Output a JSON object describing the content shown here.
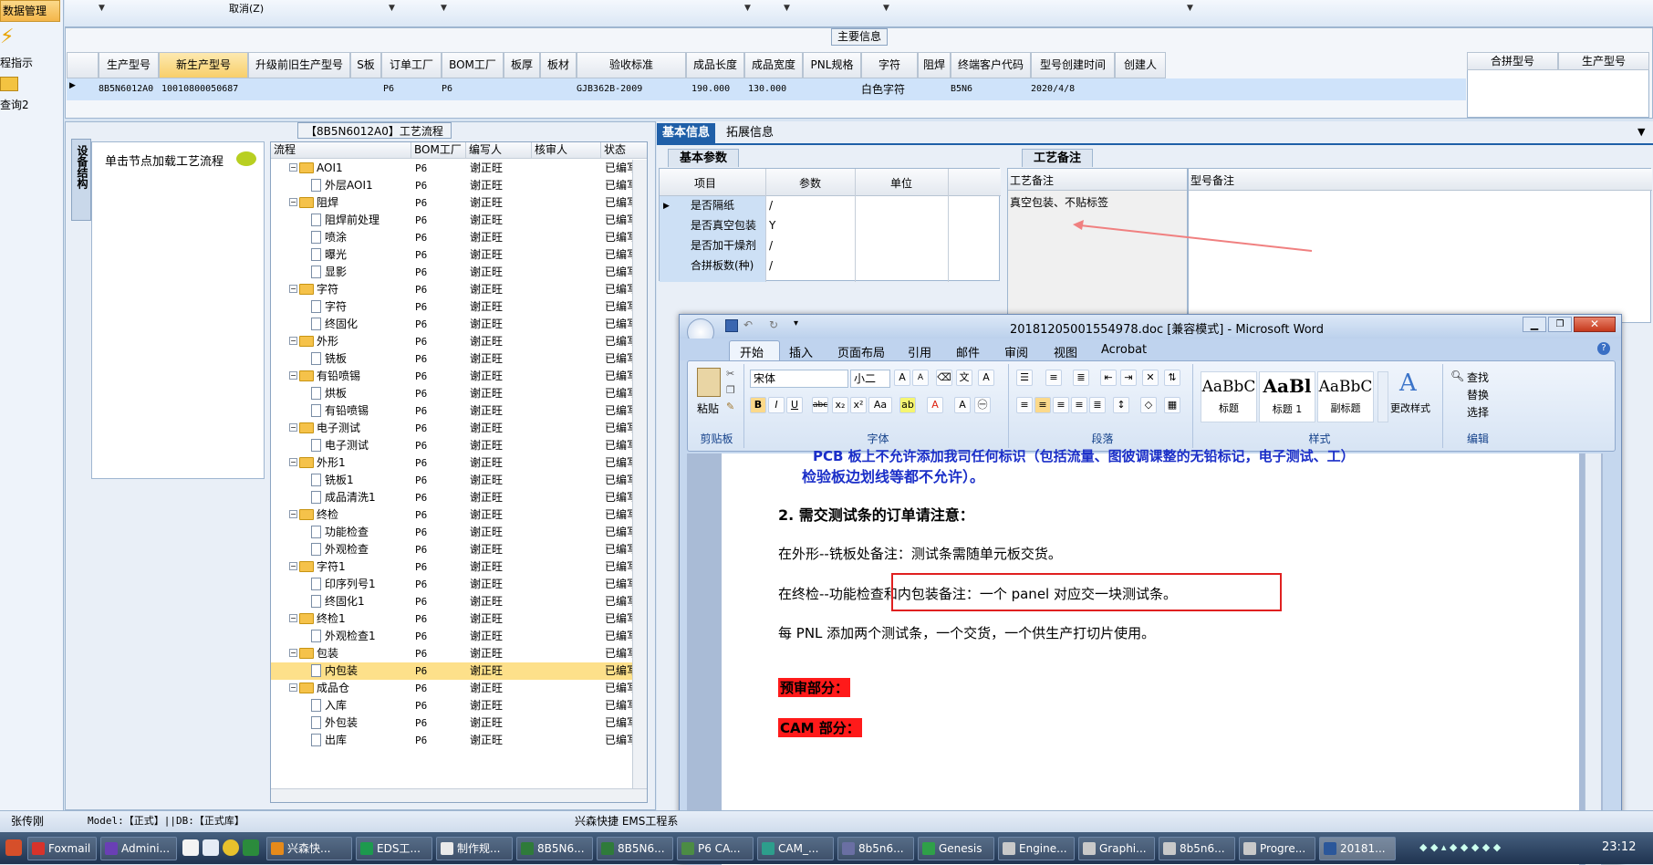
{
  "left_nav": {
    "selected": "数据管理",
    "items": [
      "程指示",
      "查询2"
    ]
  },
  "top_bar": {
    "cancel": "取消(Z)"
  },
  "main_info": {
    "group_title": "主要信息",
    "headers": [
      "生产型号",
      "新生产型号",
      "升级前旧生产型号",
      "S板",
      "订单工厂",
      "BOM工厂",
      "板厚",
      "板材",
      "验收标准",
      "成品长度",
      "成品宽度",
      "PNL规格",
      "字符",
      "阻焊",
      "终端客户代码",
      "型号创建时间",
      "创建人"
    ],
    "row": {
      "c0": "8B5N6012A0",
      "c1": "10010800050687",
      "c4": "P6",
      "c5": "P6",
      "c8": "GJB362B-2009",
      "c9": "190.000",
      "c10": "130.000",
      "c12": "白色字符",
      "c14": "B5N6",
      "c15": "2020/4/8"
    },
    "right_headers": [
      "合拼型号",
      "生产型号"
    ]
  },
  "flow": {
    "title": "【8B5N6012A0】工艺流程",
    "side_tab": "设备结构",
    "node_hint": "单击节点加载工艺流程",
    "columns": [
      "流程",
      "BOM工厂",
      "编写人",
      "核审人",
      "状态"
    ],
    "rows": [
      {
        "name": "AOI1",
        "type": "folder",
        "bom": "P6",
        "writer": "谢正旺",
        "status": "已编写"
      },
      {
        "name": "外层AOI1",
        "type": "doc",
        "bom": "P6",
        "writer": "谢正旺",
        "status": "已编写"
      },
      {
        "name": "阻焊",
        "type": "folder",
        "bom": "P6",
        "writer": "谢正旺",
        "status": "已编写"
      },
      {
        "name": "阻焊前处理",
        "type": "doc",
        "bom": "P6",
        "writer": "谢正旺",
        "status": "已编写"
      },
      {
        "name": "喷涂",
        "type": "doc",
        "bom": "P6",
        "writer": "谢正旺",
        "status": "已编写"
      },
      {
        "name": "曝光",
        "type": "doc",
        "bom": "P6",
        "writer": "谢正旺",
        "status": "已编写"
      },
      {
        "name": "显影",
        "type": "doc",
        "bom": "P6",
        "writer": "谢正旺",
        "status": "已编写"
      },
      {
        "name": "字符",
        "type": "folder",
        "bom": "P6",
        "writer": "谢正旺",
        "status": "已编写"
      },
      {
        "name": "字符",
        "type": "doc",
        "bom": "P6",
        "writer": "谢正旺",
        "status": "已编写"
      },
      {
        "name": "终固化",
        "type": "doc",
        "bom": "P6",
        "writer": "谢正旺",
        "status": "已编写"
      },
      {
        "name": "外形",
        "type": "folder",
        "bom": "P6",
        "writer": "谢正旺",
        "status": "已编写"
      },
      {
        "name": "铣板",
        "type": "doc",
        "bom": "P6",
        "writer": "谢正旺",
        "status": "已编写"
      },
      {
        "name": "有铅喷锡",
        "type": "folder",
        "bom": "P6",
        "writer": "谢正旺",
        "status": "已编写"
      },
      {
        "name": "烘板",
        "type": "doc",
        "bom": "P6",
        "writer": "谢正旺",
        "status": "已编写"
      },
      {
        "name": "有铅喷锡",
        "type": "doc",
        "bom": "P6",
        "writer": "谢正旺",
        "status": "已编写"
      },
      {
        "name": "电子测试",
        "type": "folder",
        "bom": "P6",
        "writer": "谢正旺",
        "status": "已编写"
      },
      {
        "name": "电子测试",
        "type": "doc",
        "bom": "P6",
        "writer": "谢正旺",
        "status": "已编写"
      },
      {
        "name": "外形1",
        "type": "folder",
        "bom": "P6",
        "writer": "谢正旺",
        "status": "已编写"
      },
      {
        "name": "铣板1",
        "type": "doc",
        "bom": "P6",
        "writer": "谢正旺",
        "status": "已编写"
      },
      {
        "name": "成品清洗1",
        "type": "doc",
        "bom": "P6",
        "writer": "谢正旺",
        "status": "已编写"
      },
      {
        "name": "终检",
        "type": "folder",
        "bom": "P6",
        "writer": "谢正旺",
        "status": "已编写"
      },
      {
        "name": "功能检查",
        "type": "doc",
        "bom": "P6",
        "writer": "谢正旺",
        "status": "已编写"
      },
      {
        "name": "外观检查",
        "type": "doc",
        "bom": "P6",
        "writer": "谢正旺",
        "status": "已编写"
      },
      {
        "name": "字符1",
        "type": "folder",
        "bom": "P6",
        "writer": "谢正旺",
        "status": "已编写"
      },
      {
        "name": "印序列号1",
        "type": "doc",
        "bom": "P6",
        "writer": "谢正旺",
        "status": "已编写"
      },
      {
        "name": "终固化1",
        "type": "doc",
        "bom": "P6",
        "writer": "谢正旺",
        "status": "已编写"
      },
      {
        "name": "终检1",
        "type": "folder",
        "bom": "P6",
        "writer": "谢正旺",
        "status": "已编写"
      },
      {
        "name": "外观检查1",
        "type": "doc",
        "bom": "P6",
        "writer": "谢正旺",
        "status": "已编写"
      },
      {
        "name": "包装",
        "type": "folder",
        "bom": "P6",
        "writer": "谢正旺",
        "status": "已编写"
      },
      {
        "name": "内包装",
        "type": "doc",
        "bom": "P6",
        "writer": "谢正旺",
        "status": "已编写",
        "selected": true
      },
      {
        "name": "成品仓",
        "type": "folder",
        "bom": "P6",
        "writer": "谢正旺",
        "status": "已编写"
      },
      {
        "name": "入库",
        "type": "doc",
        "bom": "P6",
        "writer": "谢正旺",
        "status": "已编写"
      },
      {
        "name": "外包装",
        "type": "doc",
        "bom": "P6",
        "writer": "谢正旺",
        "status": "已编写"
      },
      {
        "name": "出库",
        "type": "doc",
        "bom": "P6",
        "writer": "谢正旺",
        "status": "已编写"
      }
    ]
  },
  "info": {
    "tabs": [
      "基本信息",
      "拓展信息"
    ],
    "basic_params": {
      "title": "基本参数",
      "columns": [
        "项目",
        "参数",
        "单位"
      ],
      "rows": [
        {
          "item": "是否隔纸",
          "value": "/"
        },
        {
          "item": "是否真空包装",
          "value": "Y"
        },
        {
          "item": "是否加干燥剂",
          "value": "/"
        },
        {
          "item": "合拼板数(种)",
          "value": "/"
        }
      ]
    },
    "process_notes": {
      "title": "工艺备注",
      "col1": "工艺备注",
      "col2": "型号备注",
      "note": "真空包装、不贴标签"
    }
  },
  "word": {
    "title": "20181205001554978.doc [兼容模式] - Microsoft Word",
    "tabs": [
      "开始",
      "插入",
      "页面布局",
      "引用",
      "邮件",
      "审阅",
      "视图",
      "Acrobat"
    ],
    "font_name": "宋体",
    "font_size": "小二",
    "groups": {
      "clipboard": "剪贴板",
      "font": "字体",
      "paragraph": "段落",
      "styles": "样式",
      "editing": "编辑"
    },
    "paste": "粘贴",
    "styles": [
      {
        "sample": "AaBbC",
        "name": "标题"
      },
      {
        "sample": "AaBl",
        "name": "标题 1"
      },
      {
        "sample": "AaBbC",
        "name": "副标题"
      }
    ],
    "change_styles": "更改样式",
    "edit": {
      "find": "查找",
      "replace": "替换",
      "select": "选择"
    },
    "doc": {
      "line0": "PCB 板上不允许添加我司任何标识（包括流量、图彼调课整的无铅标记，电子测试、工）",
      "line1": "检验板边划线等都不允许）。",
      "heading": "2.   需交测试条的订单请注意：",
      "p1": "在外形--铣板处备注：测试条需随单元板交货。",
      "p2": "在终检--功能检查和内包装备注：一个 panel 对应交一块测试条。",
      "p3": "每 PNL 添加两个测试条，一个交货，一个供生产打切片使用。",
      "h_pre": "预审部分：",
      "h_cam": "CAM 部分："
    }
  },
  "status": {
    "user": "张传刚",
    "model": "Model:【正式】||DB:【正式库】",
    "company": "兴森快捷 EMS工程系"
  },
  "taskbar": {
    "items": [
      "Foxmail",
      "Admini...",
      "兴森快...",
      "EDS工...",
      "制作规...",
      "8B5N6...",
      "8B5N6...",
      "P6 CA...",
      "CAM_...",
      "8b5n6...",
      "Genesis",
      "Engine...",
      "Graphi...",
      "8b5n6...",
      "Progre...",
      "20181..."
    ],
    "time": "23:12"
  },
  "colors": {
    "accent": "#1f5fa8",
    "highlight": "#fde08a",
    "redbox": "#e02020",
    "annotation": "#f08080",
    "doc_blue": "#1b2fc8"
  }
}
